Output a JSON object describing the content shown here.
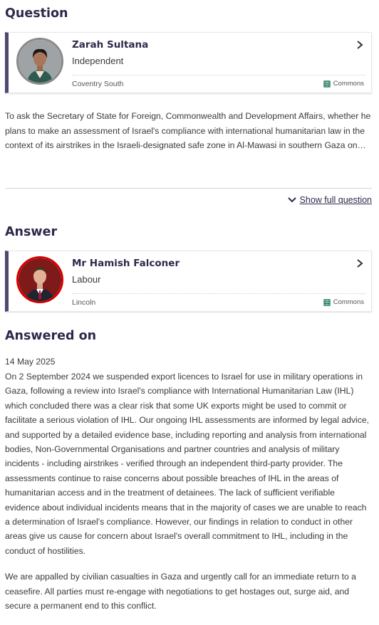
{
  "question": {
    "heading": "Question",
    "member": {
      "name": "Zarah Sultana",
      "party": "Independent",
      "constituency": "Coventry South",
      "house": "Commons"
    },
    "text": "To ask the Secretary of State for Foreign, Commonwealth and Development Affairs, whether he plans to make an assessment of Israel's compliance with international humanitarian law in the context of its airstrikes in the Israeli-designated safe zone in Al-Mawasi in southern Gaza on…",
    "show_full_label": "Show full question"
  },
  "answer": {
    "heading": "Answer",
    "member": {
      "name": "Mr Hamish Falconer",
      "party": "Labour",
      "constituency": "Lincoln",
      "house": "Commons"
    }
  },
  "answered_on": {
    "heading": "Answered on",
    "date": "14 May 2025",
    "paragraphs": [
      "On 2 September 2024 we suspended export licences to Israel for use in military operations in Gaza, following a review into Israel's compliance with International Humanitarian Law (IHL) which concluded there was a clear risk that some UK exports might be used to commit or facilitate a serious violation of IHL. Our ongoing IHL assessments are informed by legal advice, and supported by a detailed evidence base, including reporting and analysis from international bodies, Non-Governmental Organisations and partner countries and analysis of military incidents - including airstrikes - verified through an independent third-party provider. The assessments continue to raise concerns about possible breaches of IHL in the areas of humanitarian access and in the treatment of detainees. The lack of sufficient verifiable evidence about individual incidents means that in the majority of cases we are unable to reach a determination of Israel's compliance. However, our findings in relation to conduct in other areas give us cause for concern about Israel's overall commitment to IHL, including in the conduct of hostilities.",
      "We are appalled by civilian casualties in Gaza and urgently call for an immediate return to a ceasefire. All parties must re-engage with negotiations to get hostages out, surge aid, and secure a permanent end to this conflict."
    ]
  },
  "colors": {
    "card_accent": "#4d4772",
    "independent": "#8a8a8a",
    "labour": "#d50000",
    "commons": "#006548",
    "heading": "#2d2a4a"
  }
}
